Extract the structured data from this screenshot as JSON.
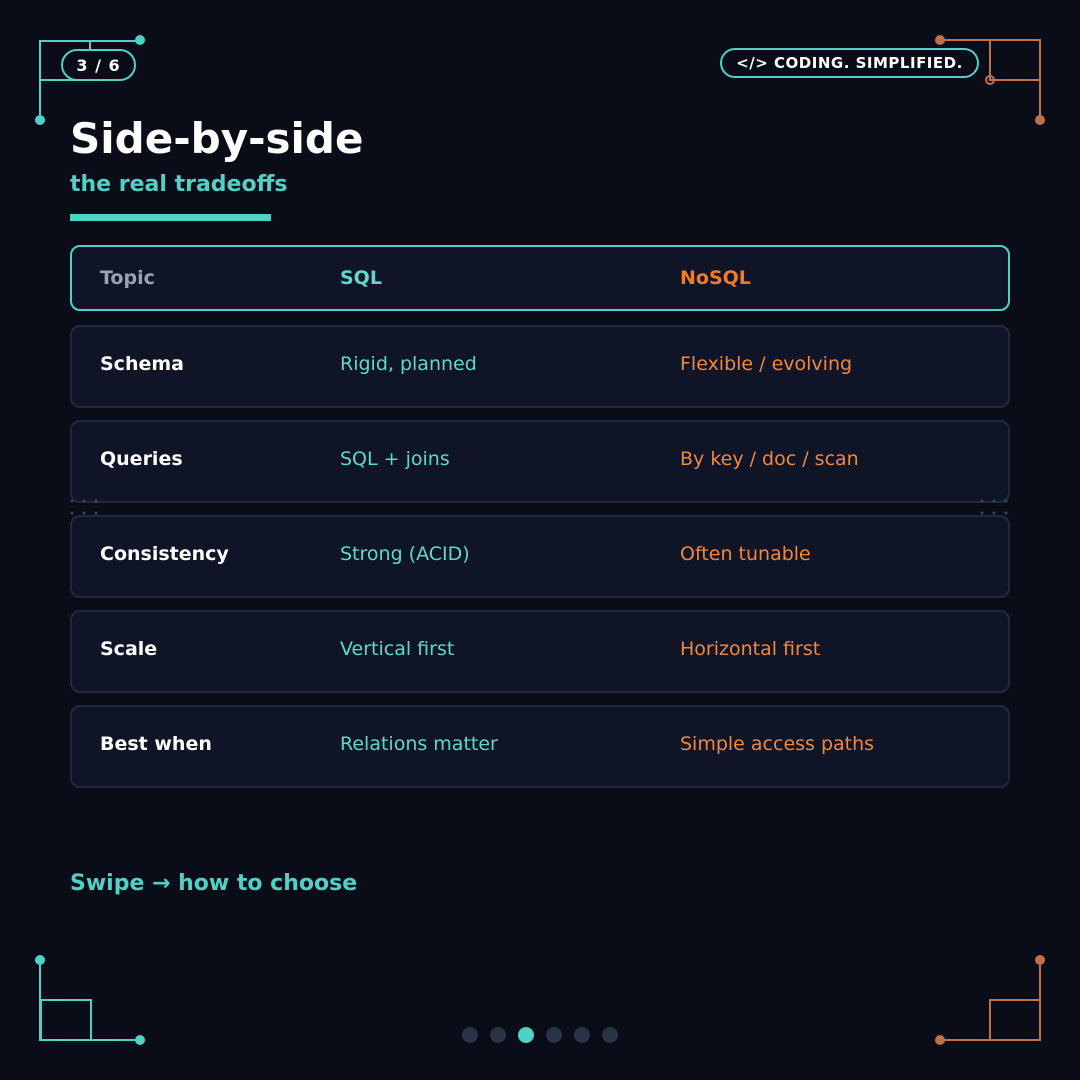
{
  "page_counter": "3 / 6",
  "brand_badge": "</> CODING. SIMPLIFIED.",
  "title": "Side-by-side",
  "subtitle": "the real tradeoffs",
  "table": {
    "header": {
      "topic": "Topic",
      "sql": "SQL",
      "nosql": "NoSQL"
    },
    "rows": [
      {
        "topic": "Schema",
        "sql": "Rigid, planned",
        "nosql": "Flexible / evolving"
      },
      {
        "topic": "Queries",
        "sql": "SQL + joins",
        "nosql": "By key / doc / scan"
      },
      {
        "topic": "Consistency",
        "sql": "Strong (ACID)",
        "nosql": "Often tunable"
      },
      {
        "topic": "Scale",
        "sql": "Vertical first",
        "nosql": "Horizontal first"
      },
      {
        "topic": "Best when",
        "sql": "Relations matter",
        "nosql": "Simple access paths"
      }
    ]
  },
  "cta": "Swipe → how to choose",
  "pager": {
    "total": 6,
    "active_index": 2
  },
  "colors": {
    "accent_teal": "#4fd1c5",
    "accent_orange": "#f47b24",
    "background": "#0a0d18",
    "card": "#0f1426"
  }
}
